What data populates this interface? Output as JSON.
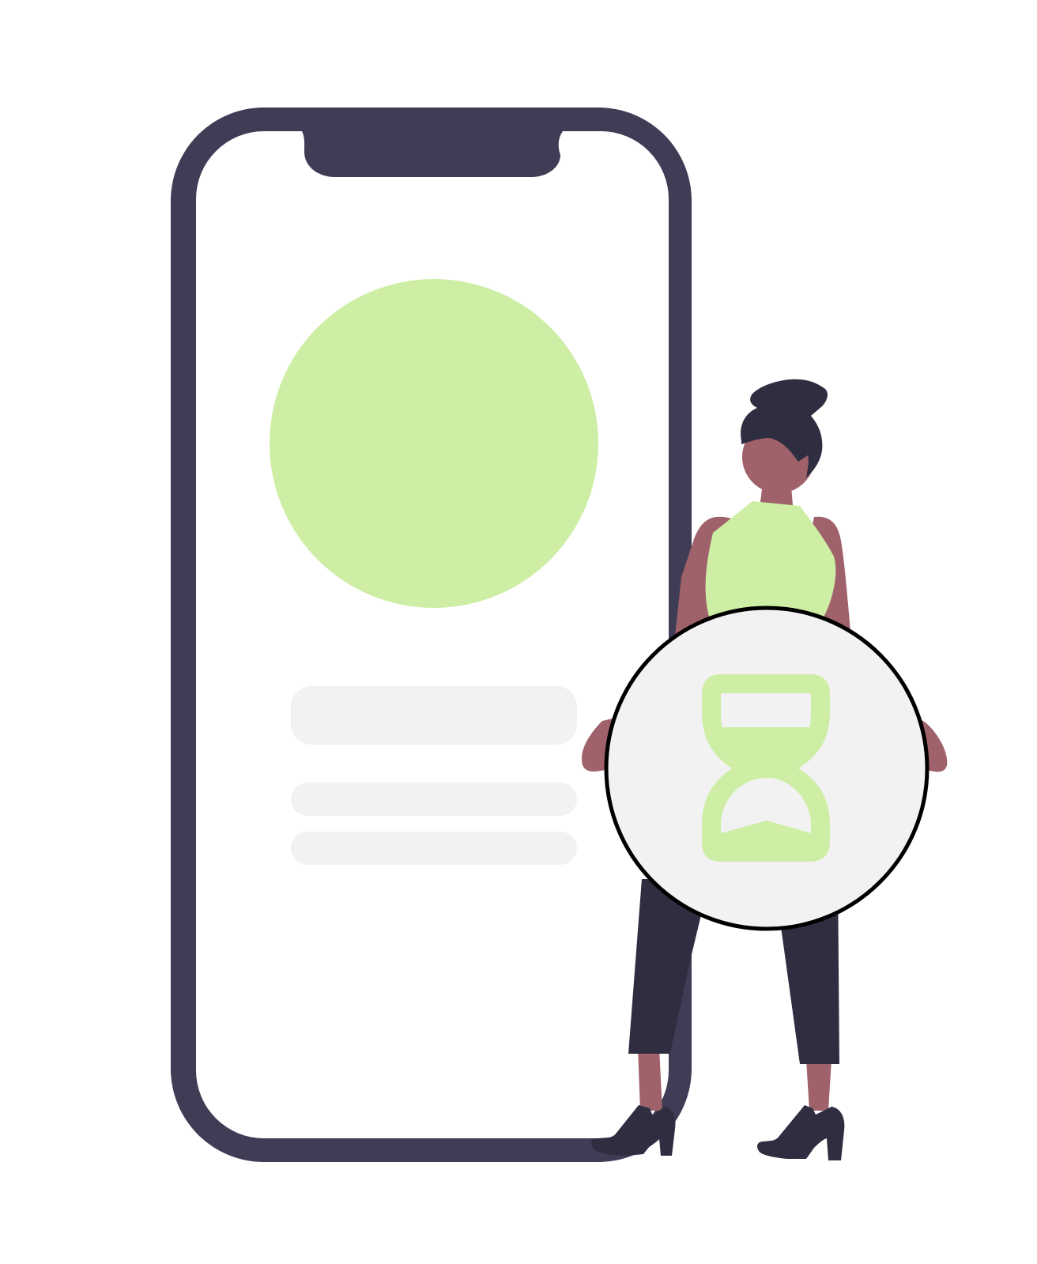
{
  "illustration": {
    "subject": "waiting-illustration",
    "icons": [
      "smartphone-icon",
      "hourglass-icon"
    ],
    "colors": {
      "background": "#ffffff",
      "phone_frame": "#3f3d56",
      "phone_screen": "#ffffff",
      "accent": "#cdeea4",
      "placeholder_bar": "#f2f2f2",
      "badge_fill": "#f2f2f2",
      "badge_outline": "#000000",
      "skin": "#9f616a",
      "hair": "#2f2e41",
      "clothing_dark": "#2f2e41"
    }
  }
}
